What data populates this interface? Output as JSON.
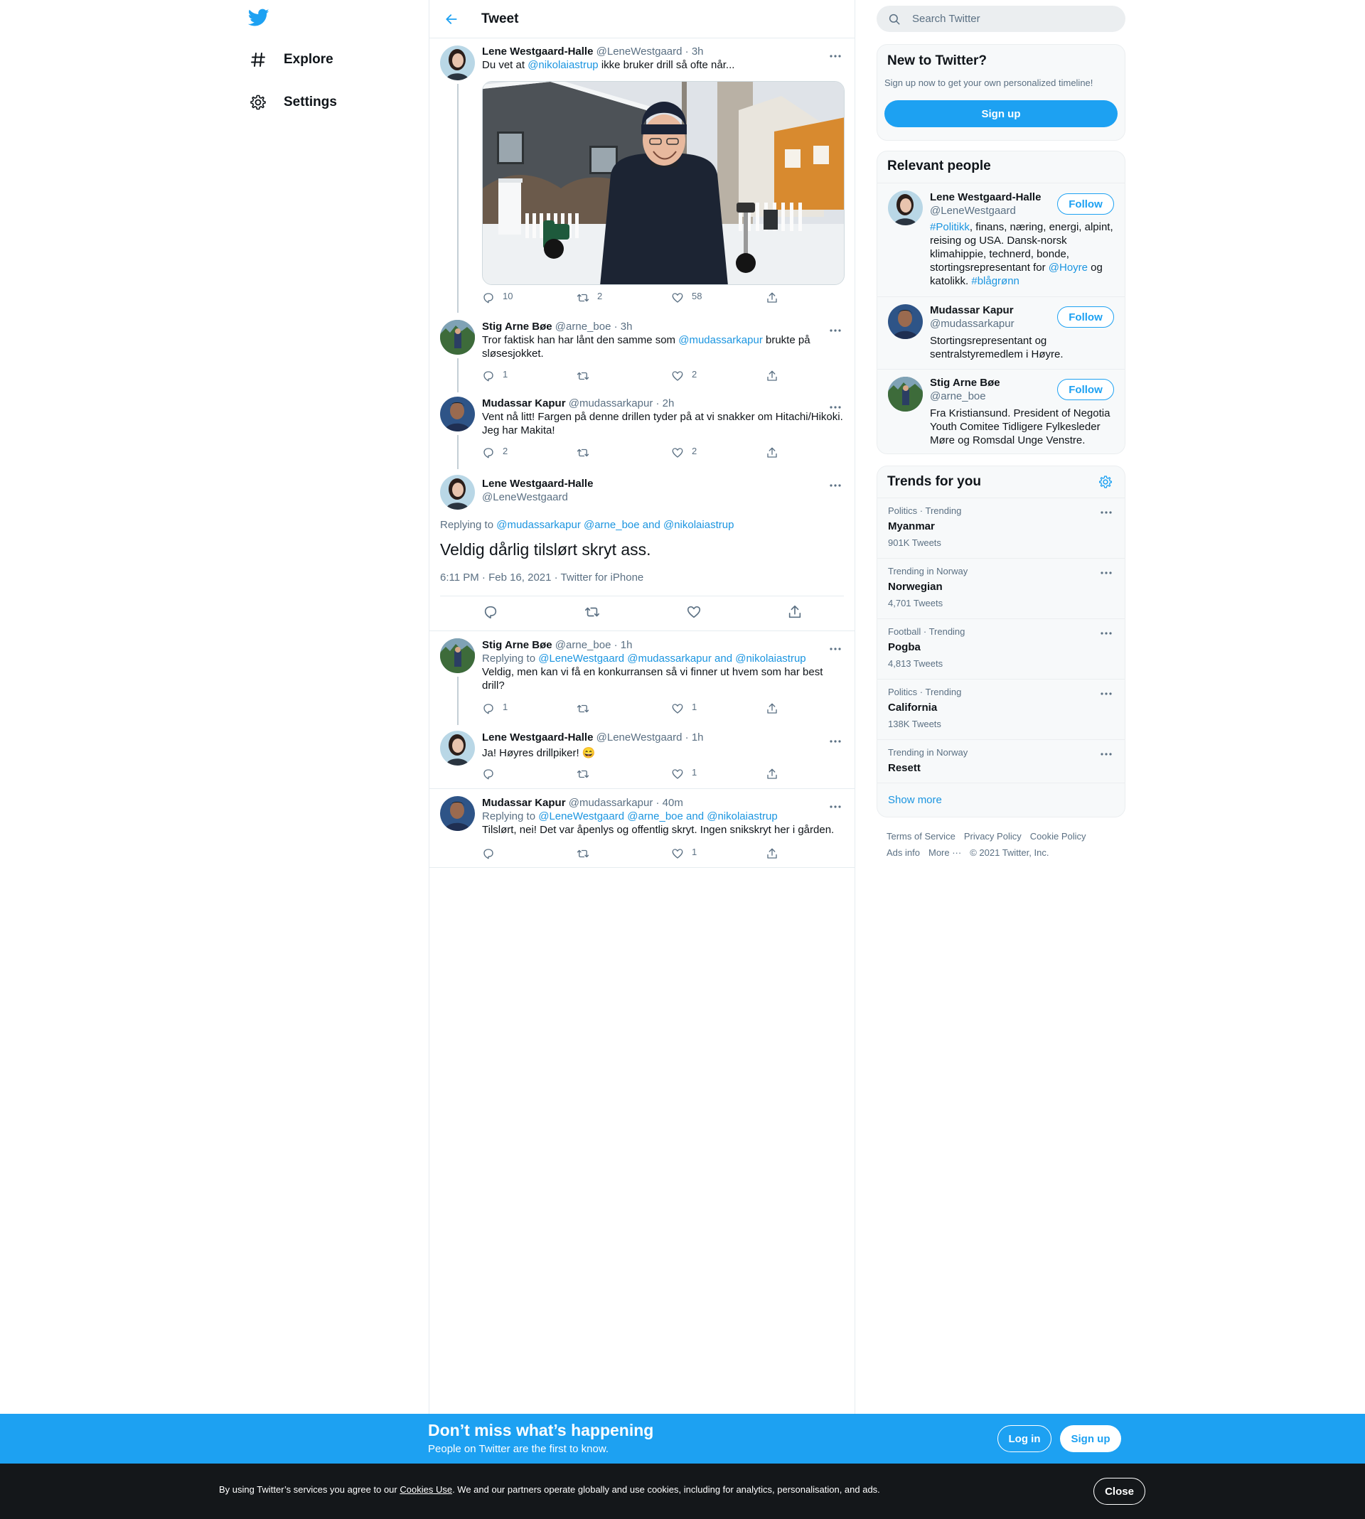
{
  "nav": {
    "explore": "Explore",
    "settings": "Settings"
  },
  "header": {
    "title": "Tweet"
  },
  "tweets": [
    {
      "name": "Lene Westgaard-Halle",
      "handle": "@LeneWestgaard",
      "time": "3h",
      "text_pre": "Du vet at ",
      "text_mention": "@nikolaiastrup",
      "text_post": " ikke bruker drill så ofte når...",
      "replies": "10",
      "retweets": "2",
      "likes": "58"
    },
    {
      "name": "Stig Arne Bøe",
      "handle": "@arne_boe",
      "time": "3h",
      "text_pre": "Tror faktisk han har lånt den samme som ",
      "text_mention": "@mudassarkapur",
      "text_post": " brukte på sløsesjokket.",
      "replies": "1",
      "retweets": "",
      "likes": "2"
    },
    {
      "name": "Mudassar Kapur",
      "handle": "@mudassarkapur",
      "time": "2h",
      "text": "Vent nå litt! Fargen på denne drillen tyder på at vi snakker om Hitachi/Hikoki. Jeg har Makita!",
      "replies": "2",
      "retweets": "",
      "likes": "2"
    }
  ],
  "main_tweet": {
    "name": "Lene Westgaard-Halle",
    "handle": "@LeneWestgaard",
    "replying_label": "Replying to ",
    "replying_to": "@mudassarkapur @arne_boe and @nikolaiastrup",
    "text": "Veldig dårlig tilslørt skryt ass.",
    "timestamp": "6:11 PM · Feb 16, 2021 · Twitter for iPhone"
  },
  "replies": [
    {
      "name": "Stig Arne Bøe",
      "handle": "@arne_boe",
      "time": "1h",
      "replying_label": "Replying to ",
      "replying_to": "@LeneWestgaard @mudassarkapur and @nikolaiastrup",
      "text": "Veldig, men kan vi få en konkurransen så vi finner ut hvem som har best drill?",
      "replies": "1",
      "retweets": "",
      "likes": "1"
    },
    {
      "name": "Lene Westgaard-Halle",
      "handle": "@LeneWestgaard",
      "time": "1h",
      "text": "Ja! Høyres drillpiker! 😄",
      "replies": "",
      "retweets": "",
      "likes": "1"
    },
    {
      "name": "Mudassar Kapur",
      "handle": "@mudassarkapur",
      "time": "40m",
      "replying_label": "Replying to ",
      "replying_to": "@LeneWestgaard @arne_boe and @nikolaiastrup",
      "text": "Tilslørt, nei! Det var åpenlys og offentlig skryt. Ingen snikskryt her i gården.",
      "replies": "",
      "retweets": "",
      "likes": "1"
    }
  ],
  "search": {
    "placeholder": "Search Twitter"
  },
  "new_to_twitter": {
    "title": "New to Twitter?",
    "subtitle": "Sign up now to get your own personalized timeline!",
    "button": "Sign up"
  },
  "relevant_people": {
    "title": "Relevant people",
    "follow_label": "Follow",
    "people": [
      {
        "name": "Lene Westgaard-Halle",
        "handle": "@LeneWestgaard",
        "bio_tag1": "#Politikk",
        "bio_mid": ", finans, næring, energi, alpint, reising og USA. Dansk-norsk klimahippie, technerd, bonde, stortingsrepresentant for ",
        "bio_tag2": "@Hoyre",
        "bio_mid2": " og katolikk. ",
        "bio_tag3": "#blågrønn"
      },
      {
        "name": "Mudassar Kapur",
        "handle": "@mudassarkapur",
        "bio": "Stortingsrepresentant og sentralstyremedlem i Høyre."
      },
      {
        "name": "Stig Arne Bøe",
        "handle": "@arne_boe",
        "bio": "Fra Kristiansund. President of Negotia Youth Comitee Tidligere Fylkesleder Møre og Romsdal Unge Venstre."
      }
    ]
  },
  "trends": {
    "title": "Trends for you",
    "items": [
      {
        "category": "Politics · Trending",
        "name": "Myanmar",
        "count": "901K Tweets"
      },
      {
        "category": "Trending in Norway",
        "name": "Norwegian",
        "count": "4,701 Tweets"
      },
      {
        "category": "Football · Trending",
        "name": "Pogba",
        "count": "4,813 Tweets"
      },
      {
        "category": "Politics · Trending",
        "name": "California",
        "count": "138K Tweets"
      },
      {
        "category": "Trending in Norway",
        "name": "Resett",
        "count": ""
      }
    ],
    "show_more": "Show more"
  },
  "footer": {
    "terms": "Terms of Service",
    "privacy": "Privacy Policy",
    "cookie": "Cookie Policy",
    "ads": "Ads info",
    "more": "More ···",
    "copyright": "© 2021 Twitter, Inc."
  },
  "banner": {
    "title": "Don’t miss what’s happening",
    "subtitle": "People on Twitter are the first to know.",
    "login": "Log in",
    "signup": "Sign up"
  },
  "cookie_bar": {
    "text_pre": "By using Twitter’s services you agree to our ",
    "link": "Cookies Use",
    "text_post": ". We and our partners operate globally and use cookies, including for analytics, personalisation, and ads.",
    "close": "Close"
  },
  "colors": {
    "accent": "#1da1f2",
    "link": "#1b95e0",
    "cookie_bg": "#14171a"
  }
}
